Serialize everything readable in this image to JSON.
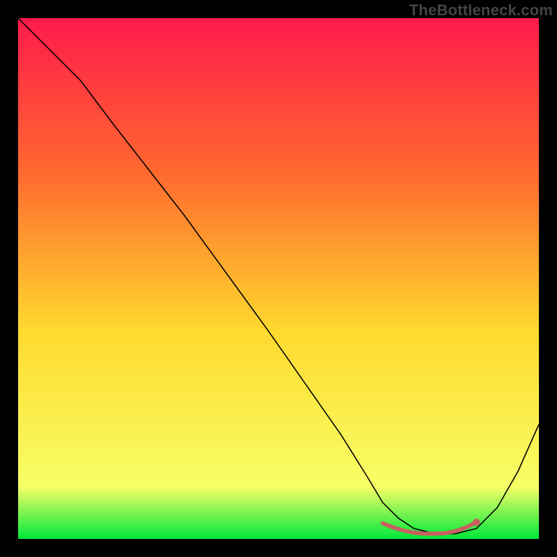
{
  "watermark": "TheBottleneck.com",
  "chart_data": {
    "type": "line",
    "title": "",
    "xlabel": "",
    "ylabel": "",
    "xlim": [
      0,
      100
    ],
    "ylim": [
      0,
      100
    ],
    "grid": false,
    "legend": false,
    "background": {
      "gradient_top": "#ff1a4b",
      "gradient_mid_upper": "#ff6a2f",
      "gradient_mid": "#ffd92e",
      "gradient_mid_lower": "#f7ff66",
      "gradient_bottom": "#00e83b"
    },
    "annotations": [],
    "series": [
      {
        "name": "main-curve",
        "stroke": "#000000",
        "stroke_width": 1.6,
        "x": [
          0,
          3,
          7,
          12,
          18,
          25,
          32,
          40,
          48,
          55,
          62,
          67,
          70,
          73,
          76,
          80,
          84,
          88,
          92,
          96,
          100
        ],
        "y": [
          100,
          97,
          93,
          88,
          80,
          71,
          62,
          51,
          40,
          30,
          20,
          12,
          7,
          4,
          2,
          1,
          1,
          2,
          6,
          13,
          22
        ]
      },
      {
        "name": "valley-highlight",
        "stroke": "#c86060",
        "stroke_width": 6,
        "style": "dotted",
        "x": [
          70,
          72,
          74,
          76,
          78,
          80,
          82,
          84,
          86,
          88
        ],
        "y": [
          3.0,
          2.2,
          1.6,
          1.2,
          1.0,
          1.0,
          1.1,
          1.5,
          2.2,
          3.2
        ]
      }
    ],
    "points": [
      {
        "name": "marker-dot",
        "x": 88,
        "y": 3.2,
        "r": 4,
        "fill": "#c86060"
      }
    ]
  }
}
